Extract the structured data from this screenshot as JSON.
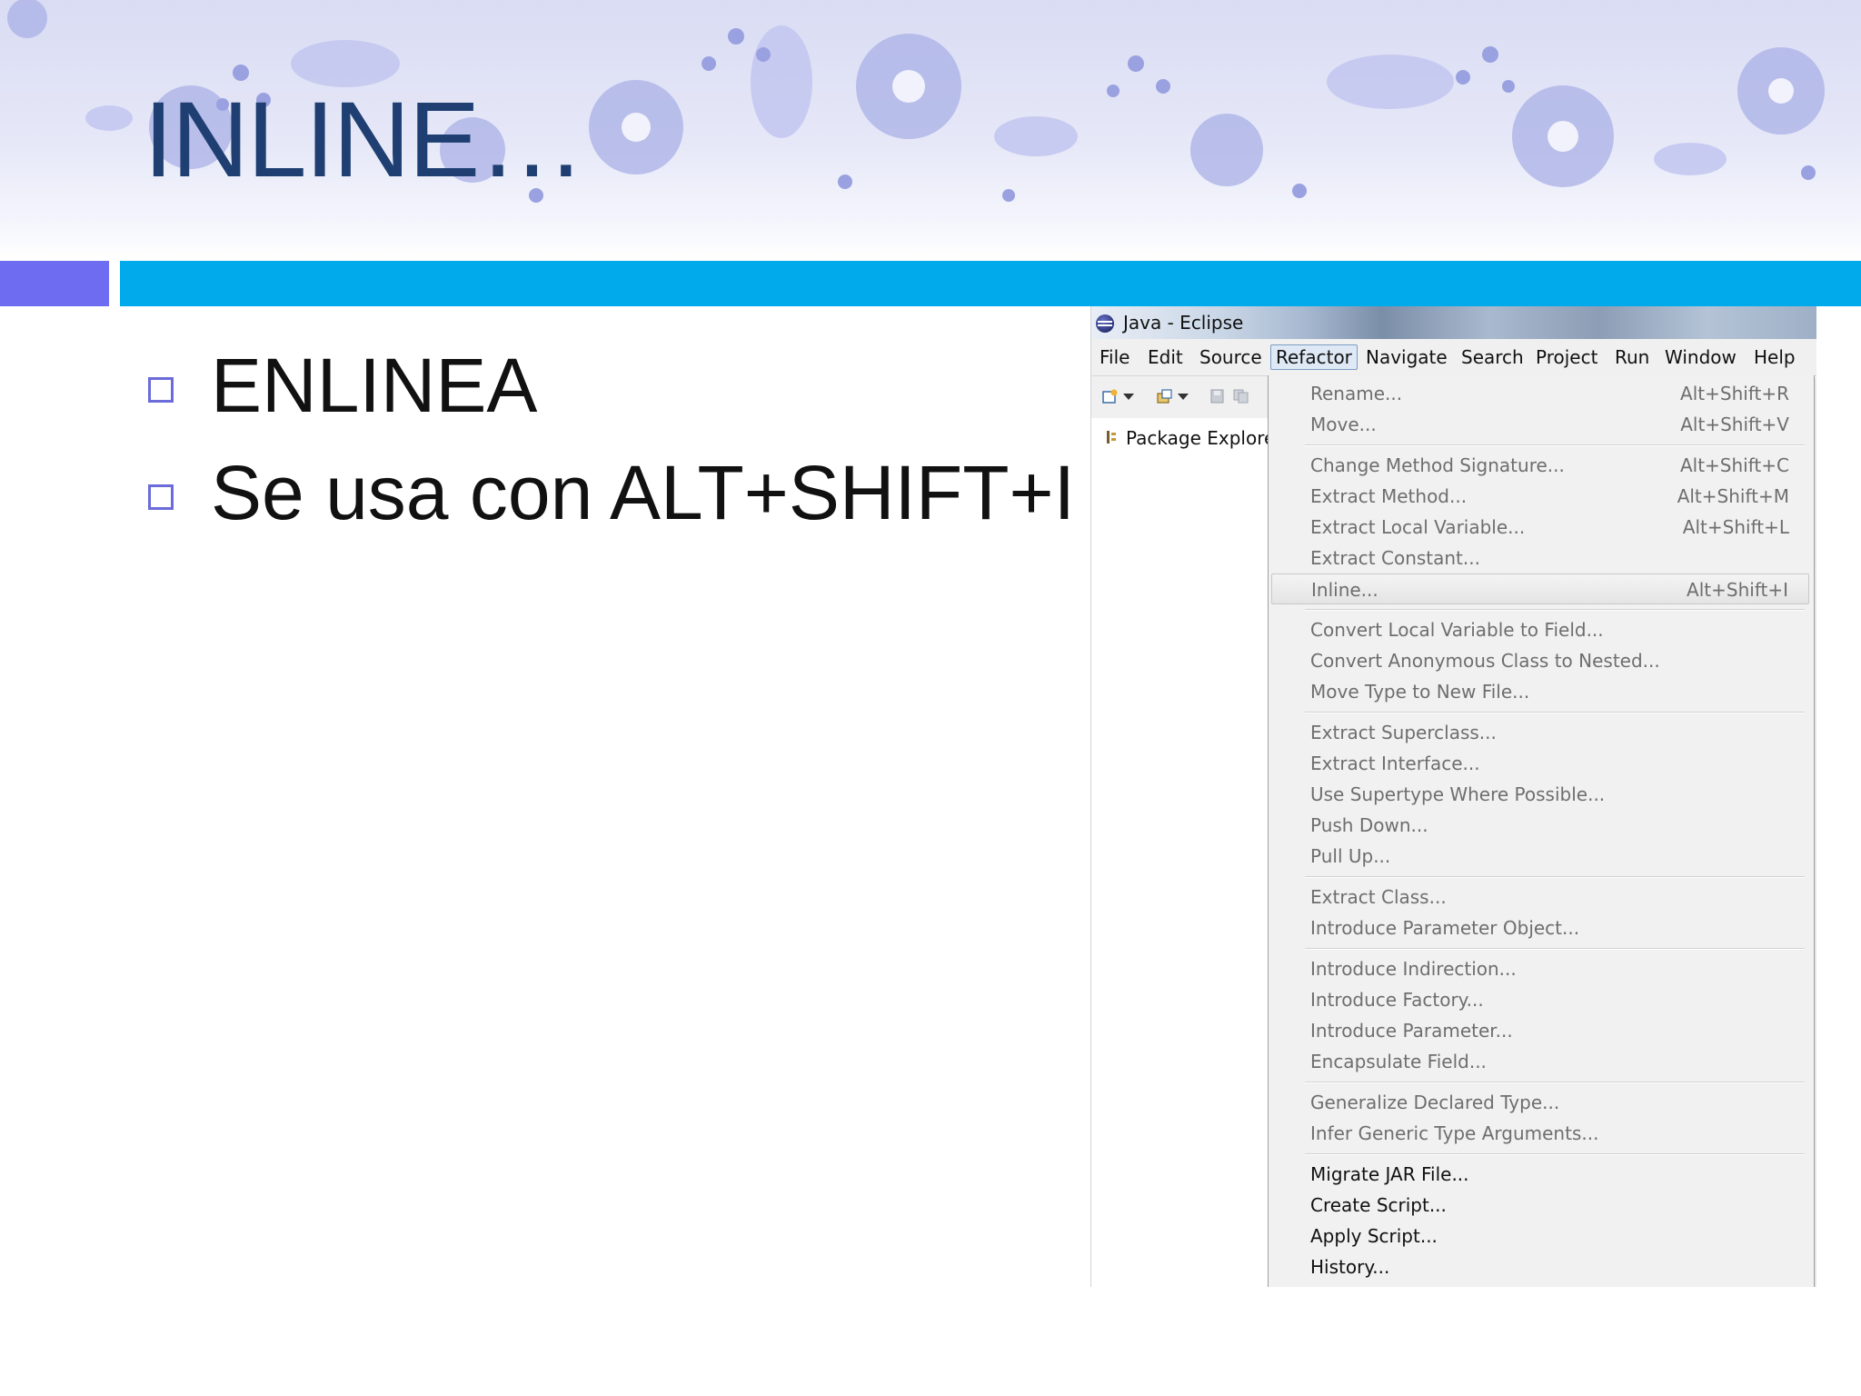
{
  "slide": {
    "title": "INLINE…",
    "bullets": [
      {
        "text": "ENLINEA"
      },
      {
        "text": "Se usa con ALT+SHIFT+I"
      }
    ]
  },
  "eclipse": {
    "window_title": "Java - Eclipse",
    "menu": [
      "File",
      "Edit",
      "Source",
      "Refactor",
      "Navigate",
      "Search",
      "Project",
      "Run",
      "Window",
      "Help"
    ],
    "active_menu": "Refactor",
    "package_explorer_label": "Package Explore",
    "refactor_menu": {
      "items": [
        {
          "label": "Rename...",
          "accel": "Alt+Shift+R"
        },
        {
          "label": "Move...",
          "accel": "Alt+Shift+V"
        },
        {
          "label": "Change Method Signature...",
          "accel": "Alt+Shift+C"
        },
        {
          "label": "Extract Method...",
          "accel": "Alt+Shift+M"
        },
        {
          "label": "Extract Local Variable...",
          "accel": "Alt+Shift+L"
        },
        {
          "label": "Extract Constant...",
          "accel": ""
        },
        {
          "label": "Inline...",
          "accel": "Alt+Shift+I"
        },
        {
          "label": "Convert Local Variable to Field...",
          "accel": ""
        },
        {
          "label": "Convert Anonymous Class to Nested...",
          "accel": ""
        },
        {
          "label": "Move Type to New File...",
          "accel": ""
        },
        {
          "label": "Extract Superclass...",
          "accel": ""
        },
        {
          "label": "Extract Interface...",
          "accel": ""
        },
        {
          "label": "Use Supertype Where Possible...",
          "accel": ""
        },
        {
          "label": "Push Down...",
          "accel": ""
        },
        {
          "label": "Pull Up...",
          "accel": ""
        },
        {
          "label": "Extract Class...",
          "accel": ""
        },
        {
          "label": "Introduce Parameter Object...",
          "accel": ""
        },
        {
          "label": "Introduce Indirection...",
          "accel": ""
        },
        {
          "label": "Introduce Factory...",
          "accel": ""
        },
        {
          "label": "Introduce Parameter...",
          "accel": ""
        },
        {
          "label": "Encapsulate Field...",
          "accel": ""
        },
        {
          "label": "Generalize Declared Type...",
          "accel": ""
        },
        {
          "label": "Infer Generic Type Arguments...",
          "accel": ""
        },
        {
          "label": "Migrate JAR File...",
          "accel": ""
        },
        {
          "label": "Create Script...",
          "accel": ""
        },
        {
          "label": "Apply Script...",
          "accel": ""
        },
        {
          "label": "History...",
          "accel": ""
        }
      ]
    }
  },
  "colors": {
    "title": "#1f3f72",
    "stripe_left": "#6e6cf1",
    "stripe_right": "#00aaeb",
    "bullet_box": "#6b6bd9"
  }
}
